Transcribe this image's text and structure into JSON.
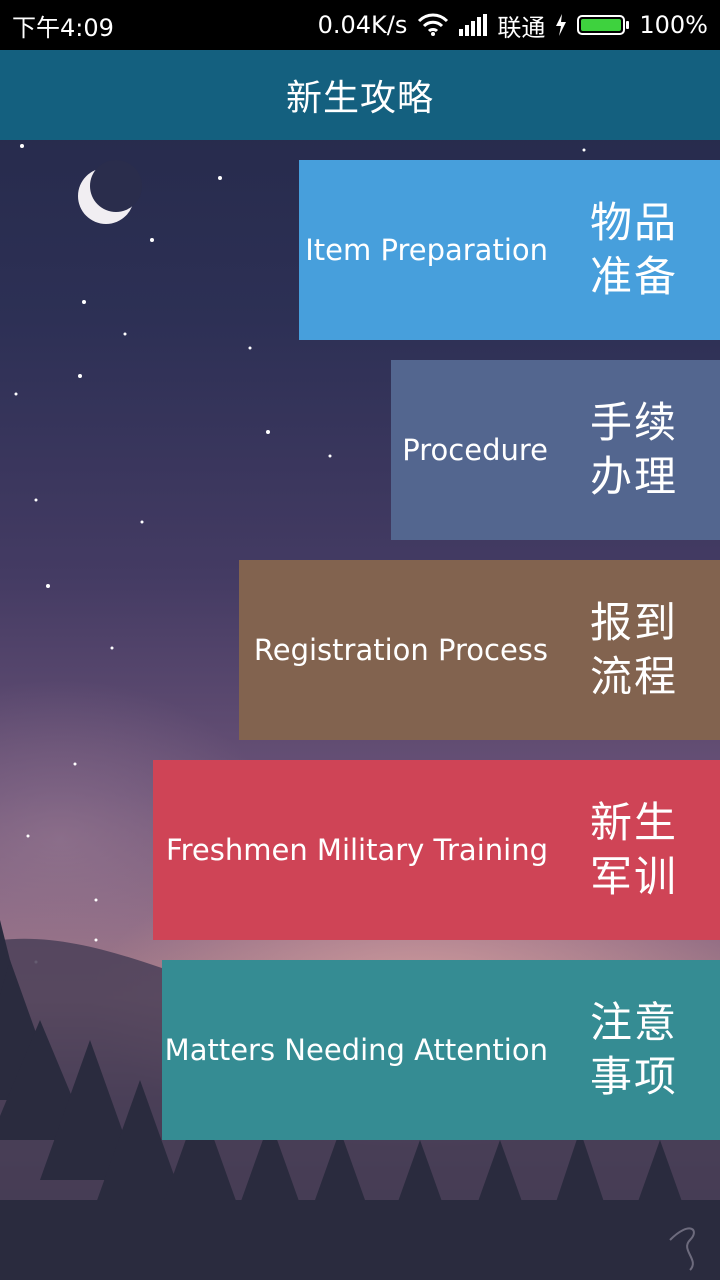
{
  "status_bar": {
    "time": "下午4:09",
    "network_speed": "0.04K/s",
    "carrier": "联通",
    "battery_percent": "100%",
    "battery_level": 1.0,
    "icons": [
      "wifi-icon",
      "signal-icon",
      "charging-icon",
      "battery-icon"
    ]
  },
  "header": {
    "title": "新生攻略"
  },
  "menu": {
    "items": [
      {
        "en": "Item Preparation",
        "cn": "物品\n准备",
        "color": "#479fdc"
      },
      {
        "en": "Procedure",
        "cn": "手续\n办理",
        "color": "#53668f"
      },
      {
        "en": "Registration Process",
        "cn": "报到\n流程",
        "color": "#82634f"
      },
      {
        "en": "Freshmen Military Training",
        "cn": "新生\n军训",
        "color": "#cf4456"
      },
      {
        "en": "Matters Needing Attention",
        "cn": "注意\n事项",
        "color": "#358c93"
      }
    ]
  },
  "background": {
    "icons": [
      "moon-icon",
      "stars",
      "pine-trees",
      "signature-icon"
    ]
  }
}
